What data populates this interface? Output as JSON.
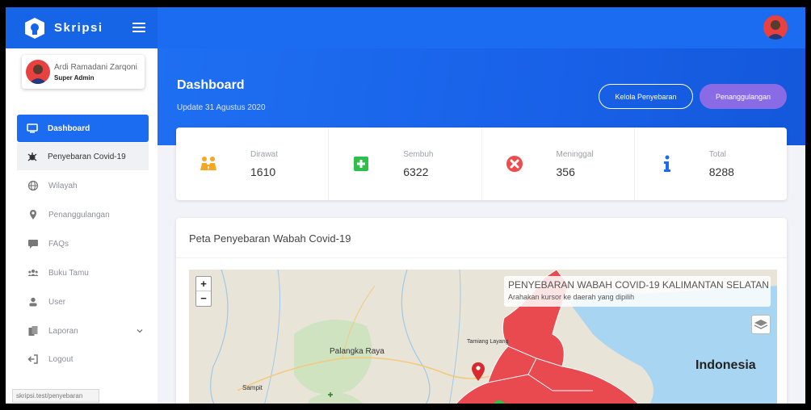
{
  "brand": {
    "name": "Skripsi"
  },
  "user": {
    "name": "Ardi Ramadani Zarqoni",
    "role": "Super Admin"
  },
  "sidebar": {
    "items": [
      {
        "label": "Dashboard",
        "icon": "monitor-icon"
      },
      {
        "label": "Penyebaran Covid-19",
        "icon": "virus-icon"
      },
      {
        "label": "Wilayah",
        "icon": "globe-icon"
      },
      {
        "label": "Penanggulangan",
        "icon": "map-marker-icon"
      },
      {
        "label": "FAQs",
        "icon": "comment-icon"
      },
      {
        "label": "Buku Tamu",
        "icon": "users-icon"
      },
      {
        "label": "User",
        "icon": "user-icon"
      },
      {
        "label": "Laporan",
        "icon": "copy-icon"
      },
      {
        "label": "Logout",
        "icon": "sign-out-icon"
      }
    ]
  },
  "status_url": "skripsi.test/penyebaran",
  "header": {
    "title": "Dashboard",
    "subtitle": "Update 31 Agustus 2020",
    "btn_kelola": "Kelola Penyebaran",
    "btn_penanggulangan": "Penanggulangan"
  },
  "stats": [
    {
      "label": "Dirawat",
      "value": "1610",
      "icon": "people-icon",
      "color": "#f5a623"
    },
    {
      "label": "Sembuh",
      "value": "6322",
      "icon": "plus-square-icon",
      "color": "#2fbf4a"
    },
    {
      "label": "Meninggal",
      "value": "356",
      "icon": "times-circle-icon",
      "color": "#ee4b4b"
    },
    {
      "label": "Total",
      "value": "8288",
      "icon": "info-icon",
      "color": "#1b6cf0"
    }
  ],
  "map": {
    "title": "Peta Penyebaran Wabah Covid-19",
    "info_title": "PENYEBARAN WABAH COVID-19 KALIMANTAN SELATAN",
    "info_hint": "Arahakan kursor ke daerah yang dipilih",
    "zoom_in": "+",
    "zoom_out": "−",
    "labels": {
      "palangka": "Palangka Raya",
      "sampit": "Sampit",
      "tamiang": "Tamiang Layang",
      "indonesia": "Indonesia"
    }
  },
  "colors": {
    "primary": "#1b6cf0",
    "accent": "#8a6be6",
    "region": "#e84a4f",
    "sea": "#a8d6f2"
  }
}
